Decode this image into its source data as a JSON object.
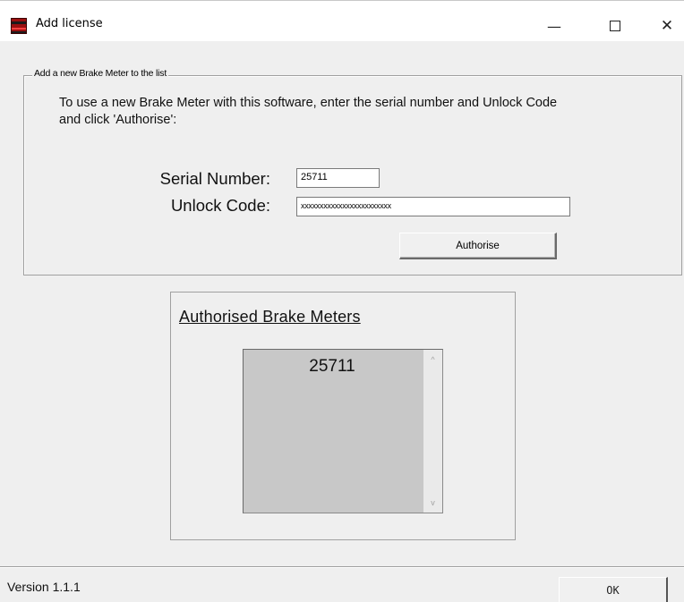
{
  "window": {
    "title": "Add license",
    "controls": {
      "minimize": "—",
      "close": "✕"
    }
  },
  "group": {
    "legend": "Add a new Brake Meter to the list",
    "instructions": "To use a new Brake Meter with this software, enter the serial number and Unlock Code and click 'Authorise':",
    "serial_label": "Serial Number:",
    "serial_value": "25711",
    "unlock_label": "Unlock Code:",
    "unlock_value": "xxxxxxxxxxxxxxxxxxxxxxxx",
    "authorise_label": "Authorise"
  },
  "authorised": {
    "heading": "Authorised Brake Meters",
    "items": [
      "25711"
    ],
    "scroll_up": "^",
    "scroll_down": "v"
  },
  "footer": {
    "version": "Version 1.1.1",
    "ok_label": "OK"
  },
  "icons": {
    "app": "brake-meter-app-icon",
    "minimize": "minimize-icon",
    "maximize": "maximize-icon",
    "close": "close-icon"
  }
}
